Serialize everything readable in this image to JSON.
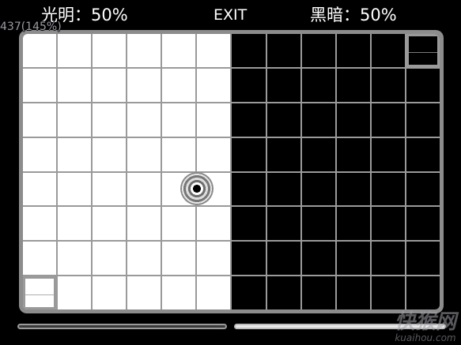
{
  "hud": {
    "light_label": "光明：50%",
    "exit_label": "EXIT",
    "dark_label": "黑暗：50%",
    "zoom_readout": "437(145%)"
  },
  "scores": {
    "light_percent": 50,
    "dark_percent": 50
  },
  "board": {
    "columns": 12,
    "rows": 8,
    "light_columns": 6,
    "light_goal": {
      "row": 8,
      "col": 1
    },
    "dark_goal": {
      "row": 1,
      "col": 12
    },
    "player": {
      "row": 5,
      "col": 5
    }
  },
  "colors": {
    "light_tile": "#ffffff",
    "dark_tile": "#000000",
    "grid_line": "#9a9a9a",
    "frame": "#8c8c8c"
  },
  "watermark": {
    "logo": "快猴网",
    "url": "kuaihou.com"
  }
}
